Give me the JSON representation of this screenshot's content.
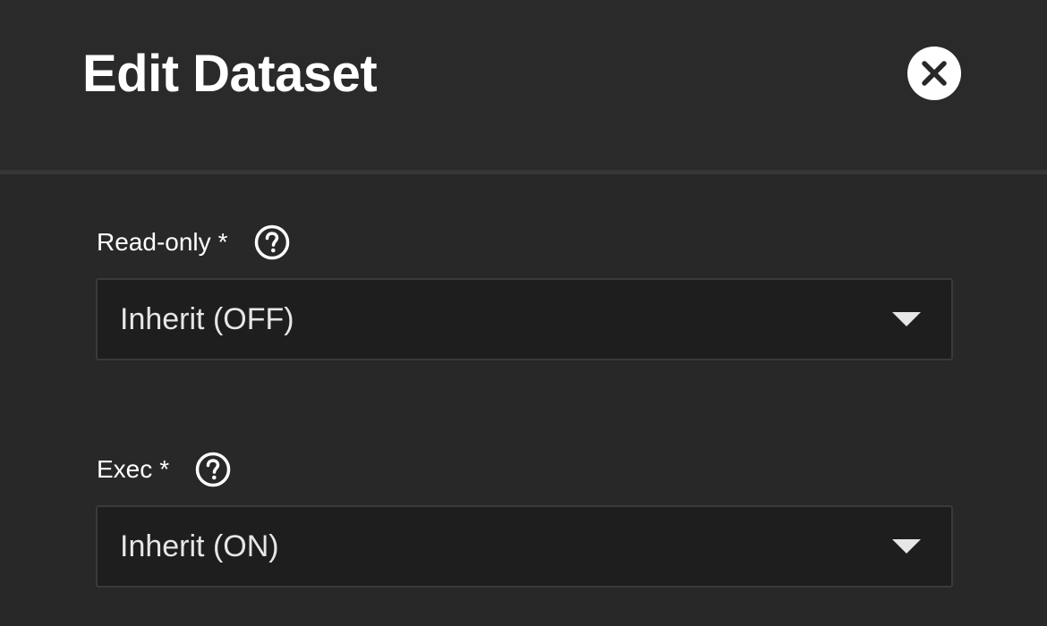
{
  "dialog": {
    "title": "Edit Dataset",
    "close_icon": "close-icon"
  },
  "fields": [
    {
      "label": "Read-only",
      "required_marker": "*",
      "help_icon": "help-icon",
      "value": "Inherit (OFF)",
      "dropdown_icon": "chevron-down-icon"
    },
    {
      "label": "Exec",
      "required_marker": "*",
      "help_icon": "help-icon",
      "value": "Inherit (ON)",
      "dropdown_icon": "chevron-down-icon"
    }
  ],
  "colors": {
    "background": "#282828",
    "field_background": "#1e1e1e",
    "text": "#ffffff"
  }
}
